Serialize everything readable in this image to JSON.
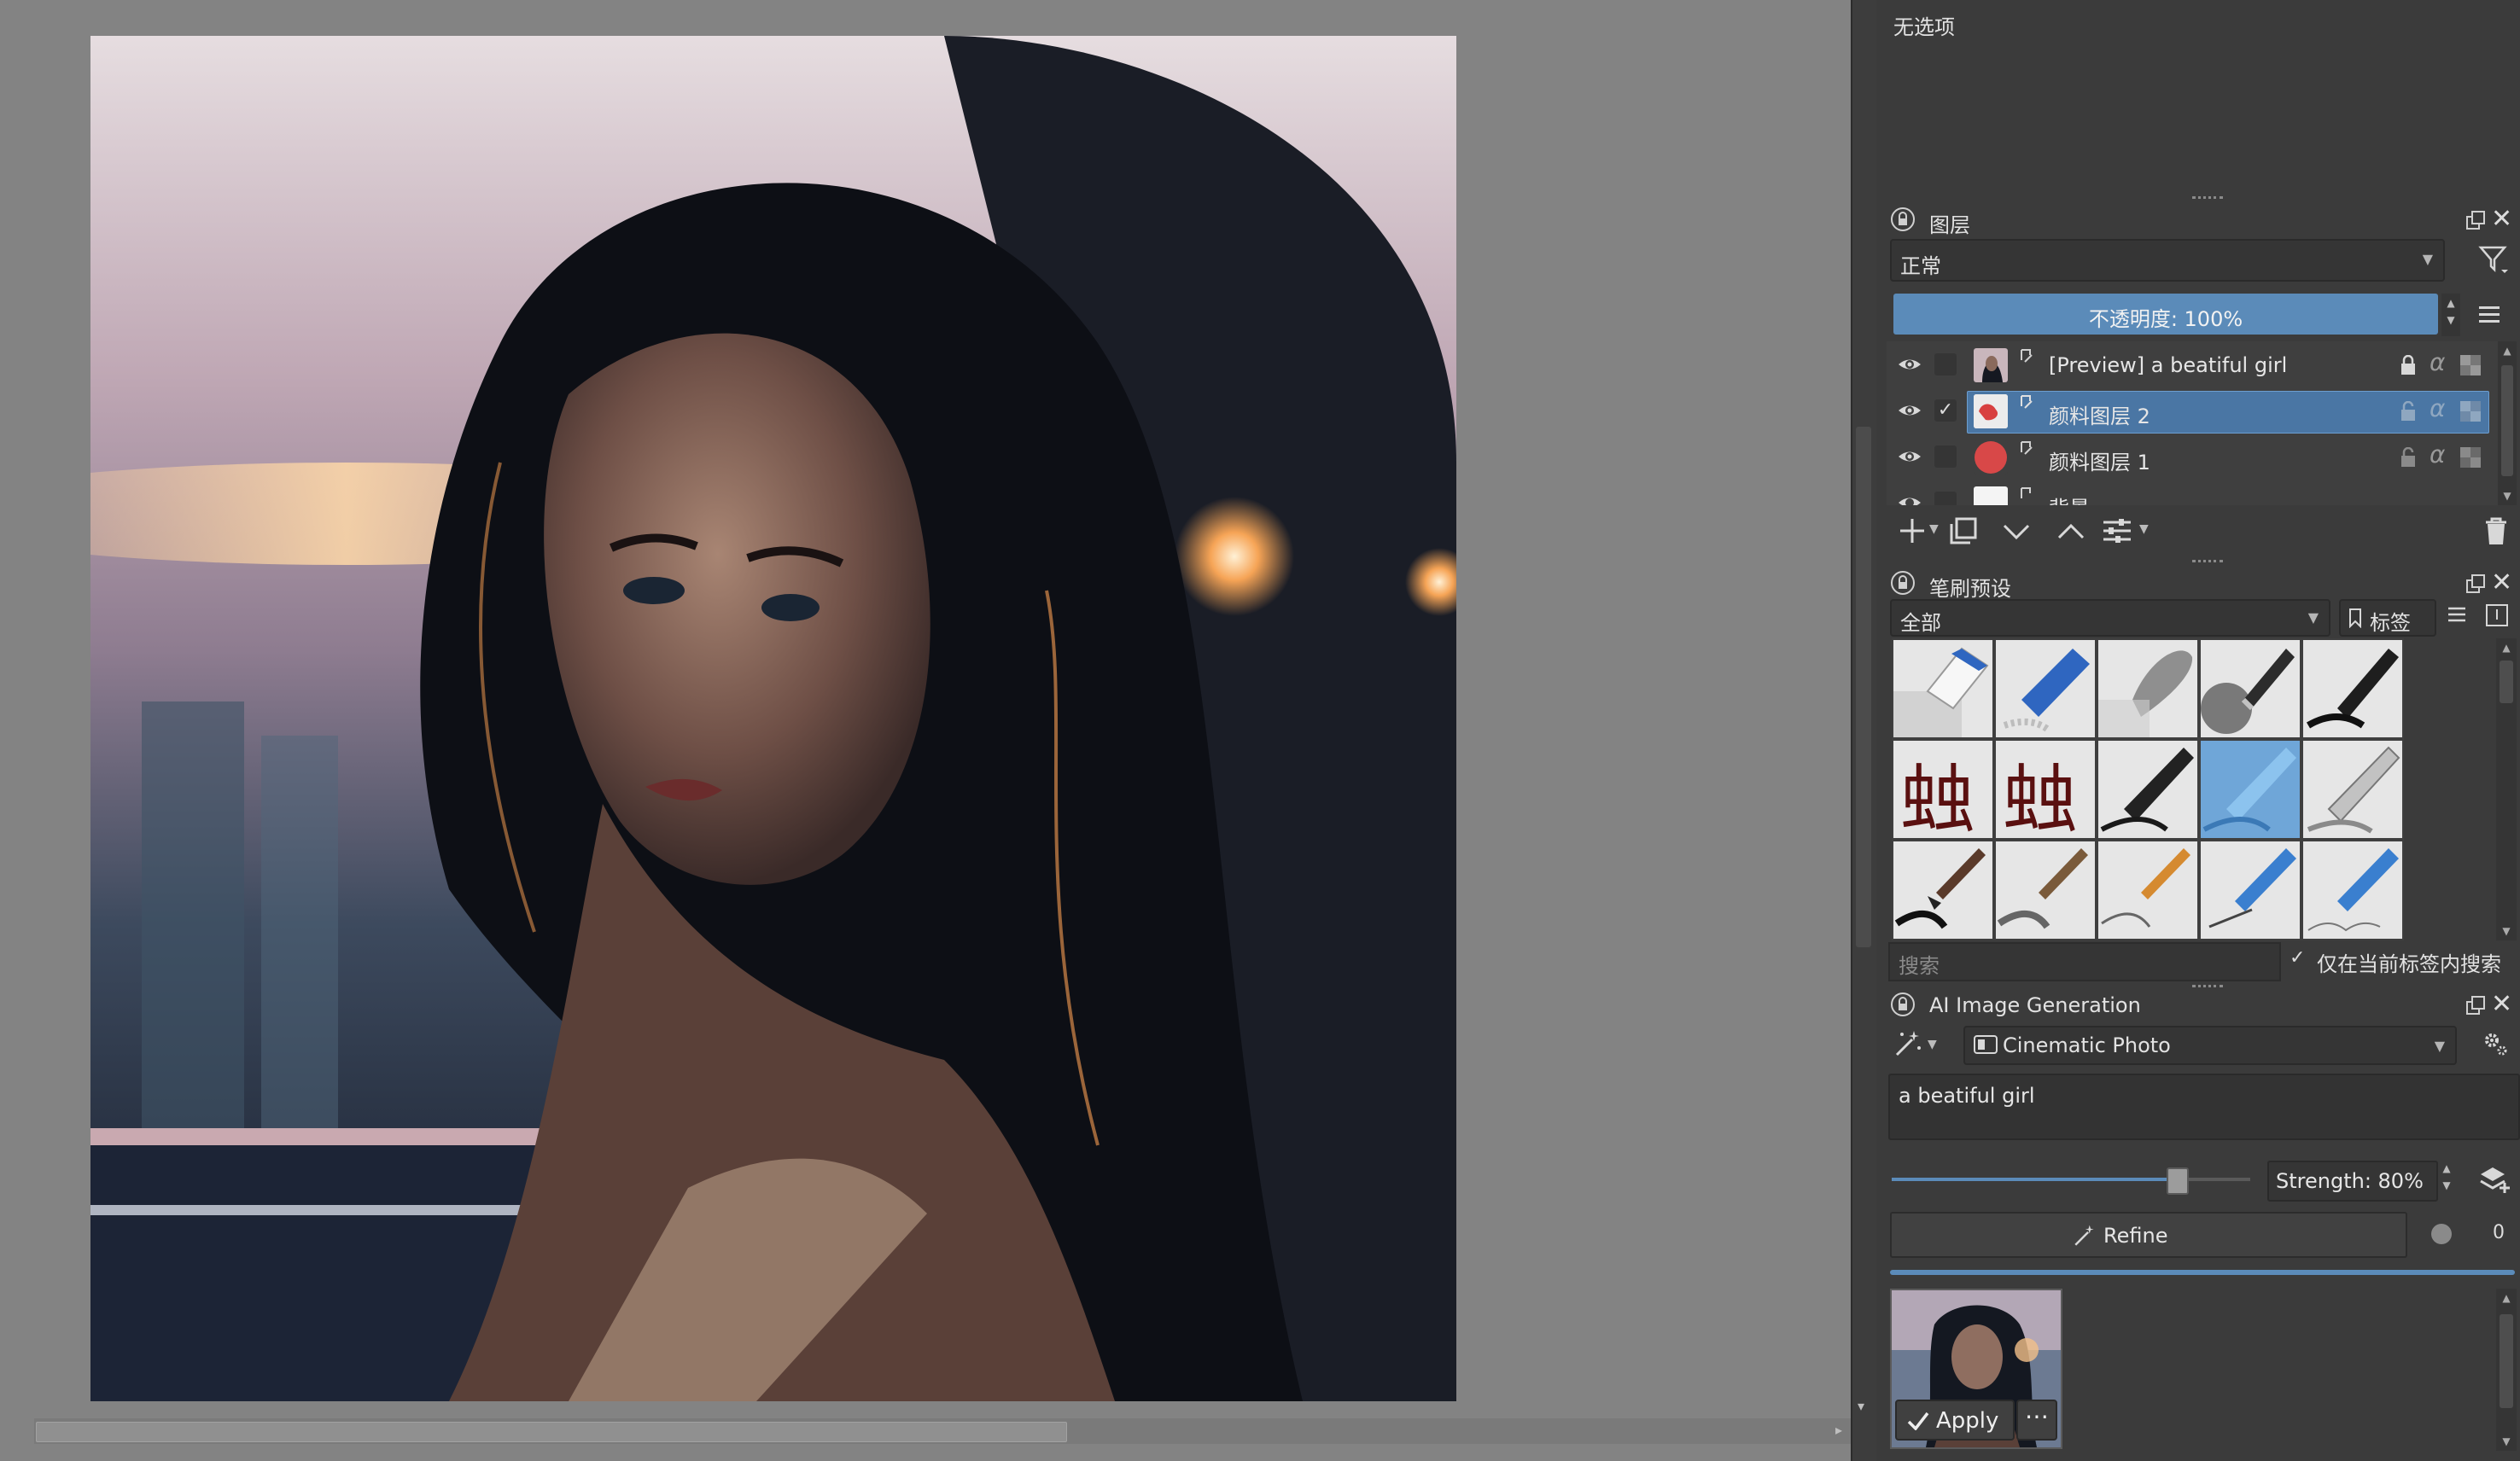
{
  "tool_options": {
    "status_text": "无选项"
  },
  "layers_panel": {
    "title": "图层",
    "blend_mode": "正常",
    "opacity_label": "不透明度:  100%",
    "layers": [
      {
        "name": "[Preview] a beatiful girl",
        "checked": false,
        "selected": false
      },
      {
        "name": "颜料图层 2",
        "checked": true,
        "selected": true,
        "check_mark": "✓"
      },
      {
        "name": "颜料图层 1",
        "checked": false,
        "selected": false
      },
      {
        "name": "背景",
        "checked": false,
        "selected": false
      }
    ]
  },
  "brush_presets_panel": {
    "title": "笔刷预设",
    "tag_filter": "全部",
    "tag_button": "标签",
    "search_placeholder": "搜索",
    "search_in_tag_label": "仅在当前标签内搜索",
    "search_in_tag_check": "✓"
  },
  "ai_panel": {
    "title": "AI Image Generation",
    "style": "Cinematic Photo",
    "prompt": "a beatiful girl",
    "strength_label": "Strength: 80%",
    "strength_value": 0.8,
    "refine_label": "Refine",
    "apply_label": "Apply",
    "more_label": "⋯",
    "seed_label": "0"
  },
  "colors": {
    "accent": "#5b8bb9",
    "panel_bg": "#3b3b3b",
    "canvas_bg": "#838383"
  }
}
